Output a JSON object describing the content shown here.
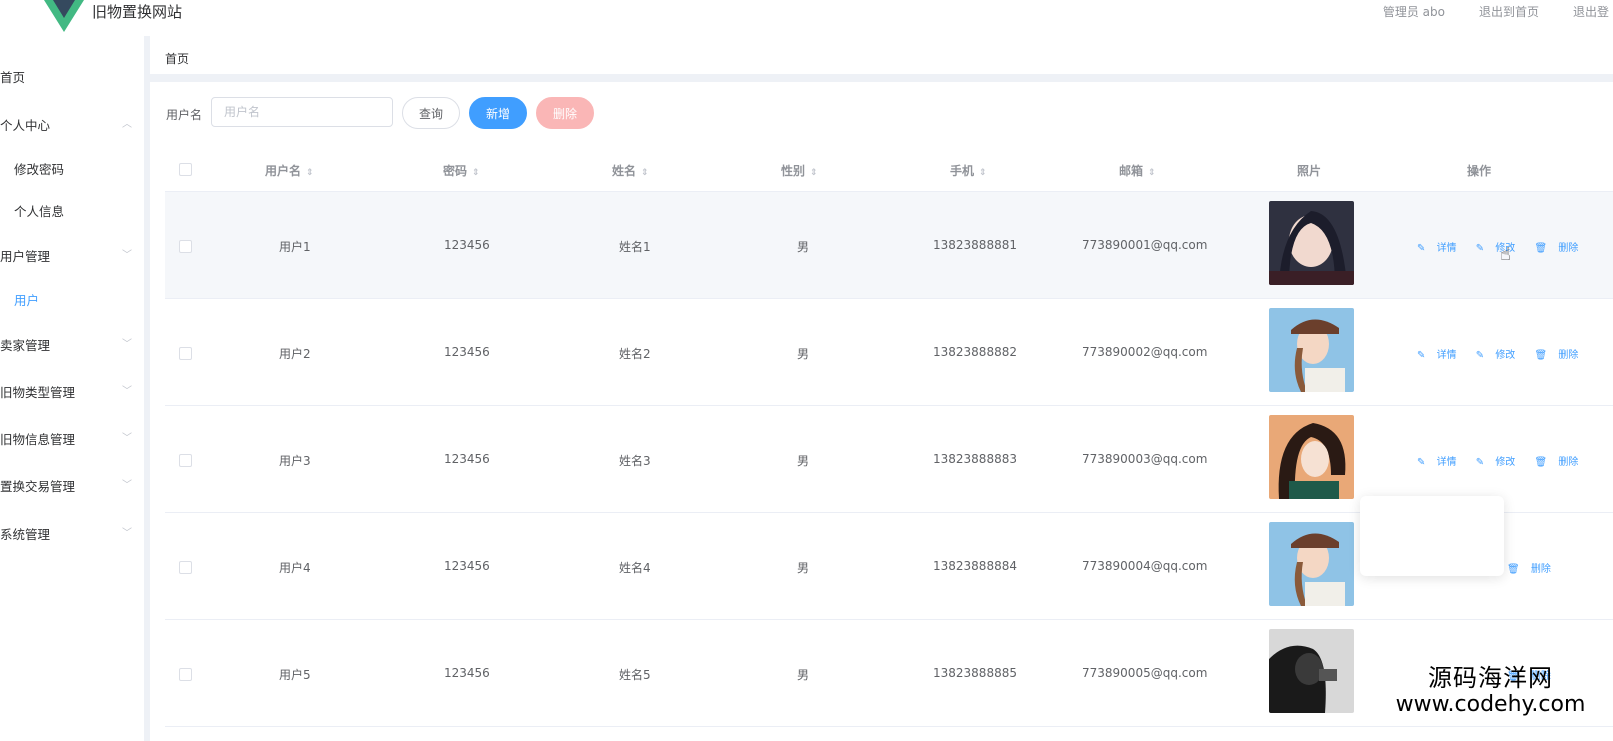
{
  "header": {
    "site_title": "旧物置换网站",
    "admin_label": "管理员 abo",
    "back_home": "退出到首页",
    "logout": "退出登"
  },
  "sidebar": {
    "items": [
      {
        "label": "首页",
        "type": "item"
      },
      {
        "label": "个人中心",
        "type": "group"
      },
      {
        "label": "修改密码",
        "type": "sub"
      },
      {
        "label": "个人信息",
        "type": "sub"
      },
      {
        "label": "用户管理",
        "type": "group"
      },
      {
        "label": "用户",
        "type": "sub",
        "active": true
      },
      {
        "label": "卖家管理",
        "type": "group"
      },
      {
        "label": "旧物类型管理",
        "type": "group"
      },
      {
        "label": "旧物信息管理",
        "type": "group"
      },
      {
        "label": "置换交易管理",
        "type": "group"
      },
      {
        "label": "系统管理",
        "type": "group"
      }
    ]
  },
  "breadcrumb": {
    "current": "首页"
  },
  "search": {
    "label": "用户名",
    "placeholder": "用户名",
    "query_label": "查询",
    "add_label": "新增",
    "delete_label": "删除"
  },
  "table": {
    "headers": [
      "用户名",
      "密码",
      "姓名",
      "性别",
      "手机",
      "邮箱",
      "照片",
      "操作"
    ],
    "rows": [
      {
        "username": "用户1",
        "password": "123456",
        "name": "姓名1",
        "gender": "男",
        "phone": "13823888881",
        "email": "773890001@qq.com"
      },
      {
        "username": "用户2",
        "password": "123456",
        "name": "姓名2",
        "gender": "男",
        "phone": "13823888882",
        "email": "773890002@qq.com"
      },
      {
        "username": "用户3",
        "password": "123456",
        "name": "姓名3",
        "gender": "男",
        "phone": "13823888883",
        "email": "773890003@qq.com"
      },
      {
        "username": "用户4",
        "password": "123456",
        "name": "姓名4",
        "gender": "男",
        "phone": "13823888884",
        "email": "773890004@qq.com"
      },
      {
        "username": "用户5",
        "password": "123456",
        "name": "姓名5",
        "gender": "男",
        "phone": "13823888885",
        "email": "773890005@qq.com"
      }
    ],
    "ops": {
      "detail": "详情",
      "edit": "修改",
      "delete": "删除"
    }
  },
  "watermark": {
    "line1": "源码海洋网",
    "line2": "www.codehy.com"
  },
  "colors": {
    "primary": "#409eff",
    "danger_light": "#fab6b6",
    "logo_green": "#42b983",
    "logo_dark": "#35495e"
  }
}
